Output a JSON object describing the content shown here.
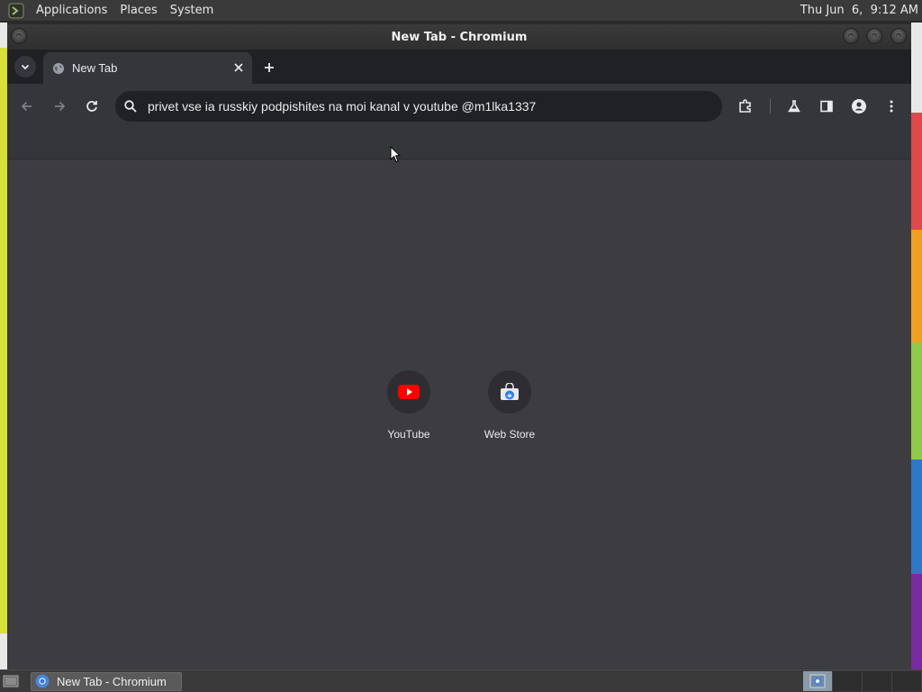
{
  "top_panel": {
    "menus": [
      "Applications",
      "Places",
      "System"
    ],
    "clock": "Thu Jun  6,  9:12 AM"
  },
  "window": {
    "title": "New Tab - Chromium"
  },
  "tabs": [
    {
      "title": "New Tab",
      "favicon": "globe-icon"
    }
  ],
  "toolbar": {
    "omnibox_value": "privet vse ia russkiy podpishites na moi kanal v youtube @m1lka1337"
  },
  "new_tab_page": {
    "shortcuts": [
      {
        "label": "YouTube",
        "icon": "youtube-icon"
      },
      {
        "label": "Web Store",
        "icon": "web-store-icon"
      }
    ]
  },
  "taskbar": {
    "task_label": "New Tab - Chromium"
  },
  "colors": {
    "tab_strip": "#202124",
    "toolbar": "#35363a",
    "ntp_background": "#3c3c41",
    "youtube_red": "#ff0000"
  }
}
